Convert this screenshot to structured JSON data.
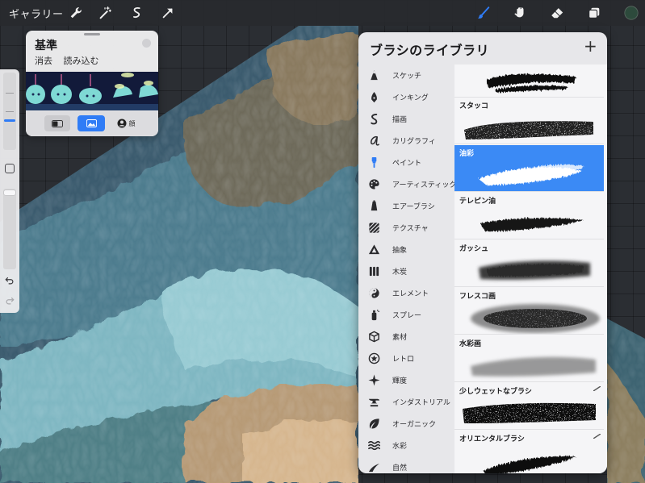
{
  "toolbar": {
    "gallery_label": "ギャラリー",
    "tools": [
      {
        "name": "actions"
      },
      {
        "name": "adjustments"
      },
      {
        "name": "selection"
      },
      {
        "name": "transform"
      }
    ],
    "right_tools": [
      "brush",
      "smudge",
      "eraser",
      "layers",
      "color"
    ],
    "active_color": "#2d4a3c",
    "accent_color": "#2f7cf6"
  },
  "reference_panel": {
    "title": "基準",
    "actions": [
      "消去",
      "読み込む"
    ],
    "bar_right_label": "顔"
  },
  "brush_library": {
    "title": "ブラシのライブラリ",
    "add_label": "+",
    "categories": [
      {
        "label": "スケッチ",
        "icon": "pencil-tip-icon"
      },
      {
        "label": "インキング",
        "icon": "pen-nib-icon"
      },
      {
        "label": "描画",
        "icon": "squiggle-icon"
      },
      {
        "label": "カリグラフィ",
        "icon": "calligraphy-a-icon"
      },
      {
        "label": "ペイント",
        "icon": "paint-brush-icon"
      },
      {
        "label": "アーティスティック",
        "icon": "palette-icon"
      },
      {
        "label": "エアーブラシ",
        "icon": "airbrush-icon"
      },
      {
        "label": "テクスチャ",
        "icon": "texture-icon"
      },
      {
        "label": "抽象",
        "icon": "triangle-icon"
      },
      {
        "label": "木炭",
        "icon": "charcoal-icon"
      },
      {
        "label": "エレメント",
        "icon": "yin-yang-icon"
      },
      {
        "label": "スプレー",
        "icon": "spray-can-icon"
      },
      {
        "label": "素材",
        "icon": "cube-icon"
      },
      {
        "label": "レトロ",
        "icon": "star-badge-icon"
      },
      {
        "label": "輝度",
        "icon": "sparkle-icon"
      },
      {
        "label": "インダストリアル",
        "icon": "anvil-icon"
      },
      {
        "label": "オーガニック",
        "icon": "leaf-icon"
      },
      {
        "label": "水彩",
        "icon": "waves-icon"
      },
      {
        "label": "自然",
        "icon": "stroke-icon"
      }
    ],
    "brushes": [
      {
        "label": "",
        "selected": false
      },
      {
        "label": "スタッコ",
        "selected": false
      },
      {
        "label": "油彩",
        "selected": true
      },
      {
        "label": "テレピン油",
        "selected": false
      },
      {
        "label": "ガッシュ",
        "selected": false
      },
      {
        "label": "フレスコ画",
        "selected": false
      },
      {
        "label": "水彩画",
        "selected": false
      },
      {
        "label": "少しウェットなブラシ",
        "selected": false
      },
      {
        "label": "オリエンタルブラシ",
        "selected": false
      }
    ]
  }
}
